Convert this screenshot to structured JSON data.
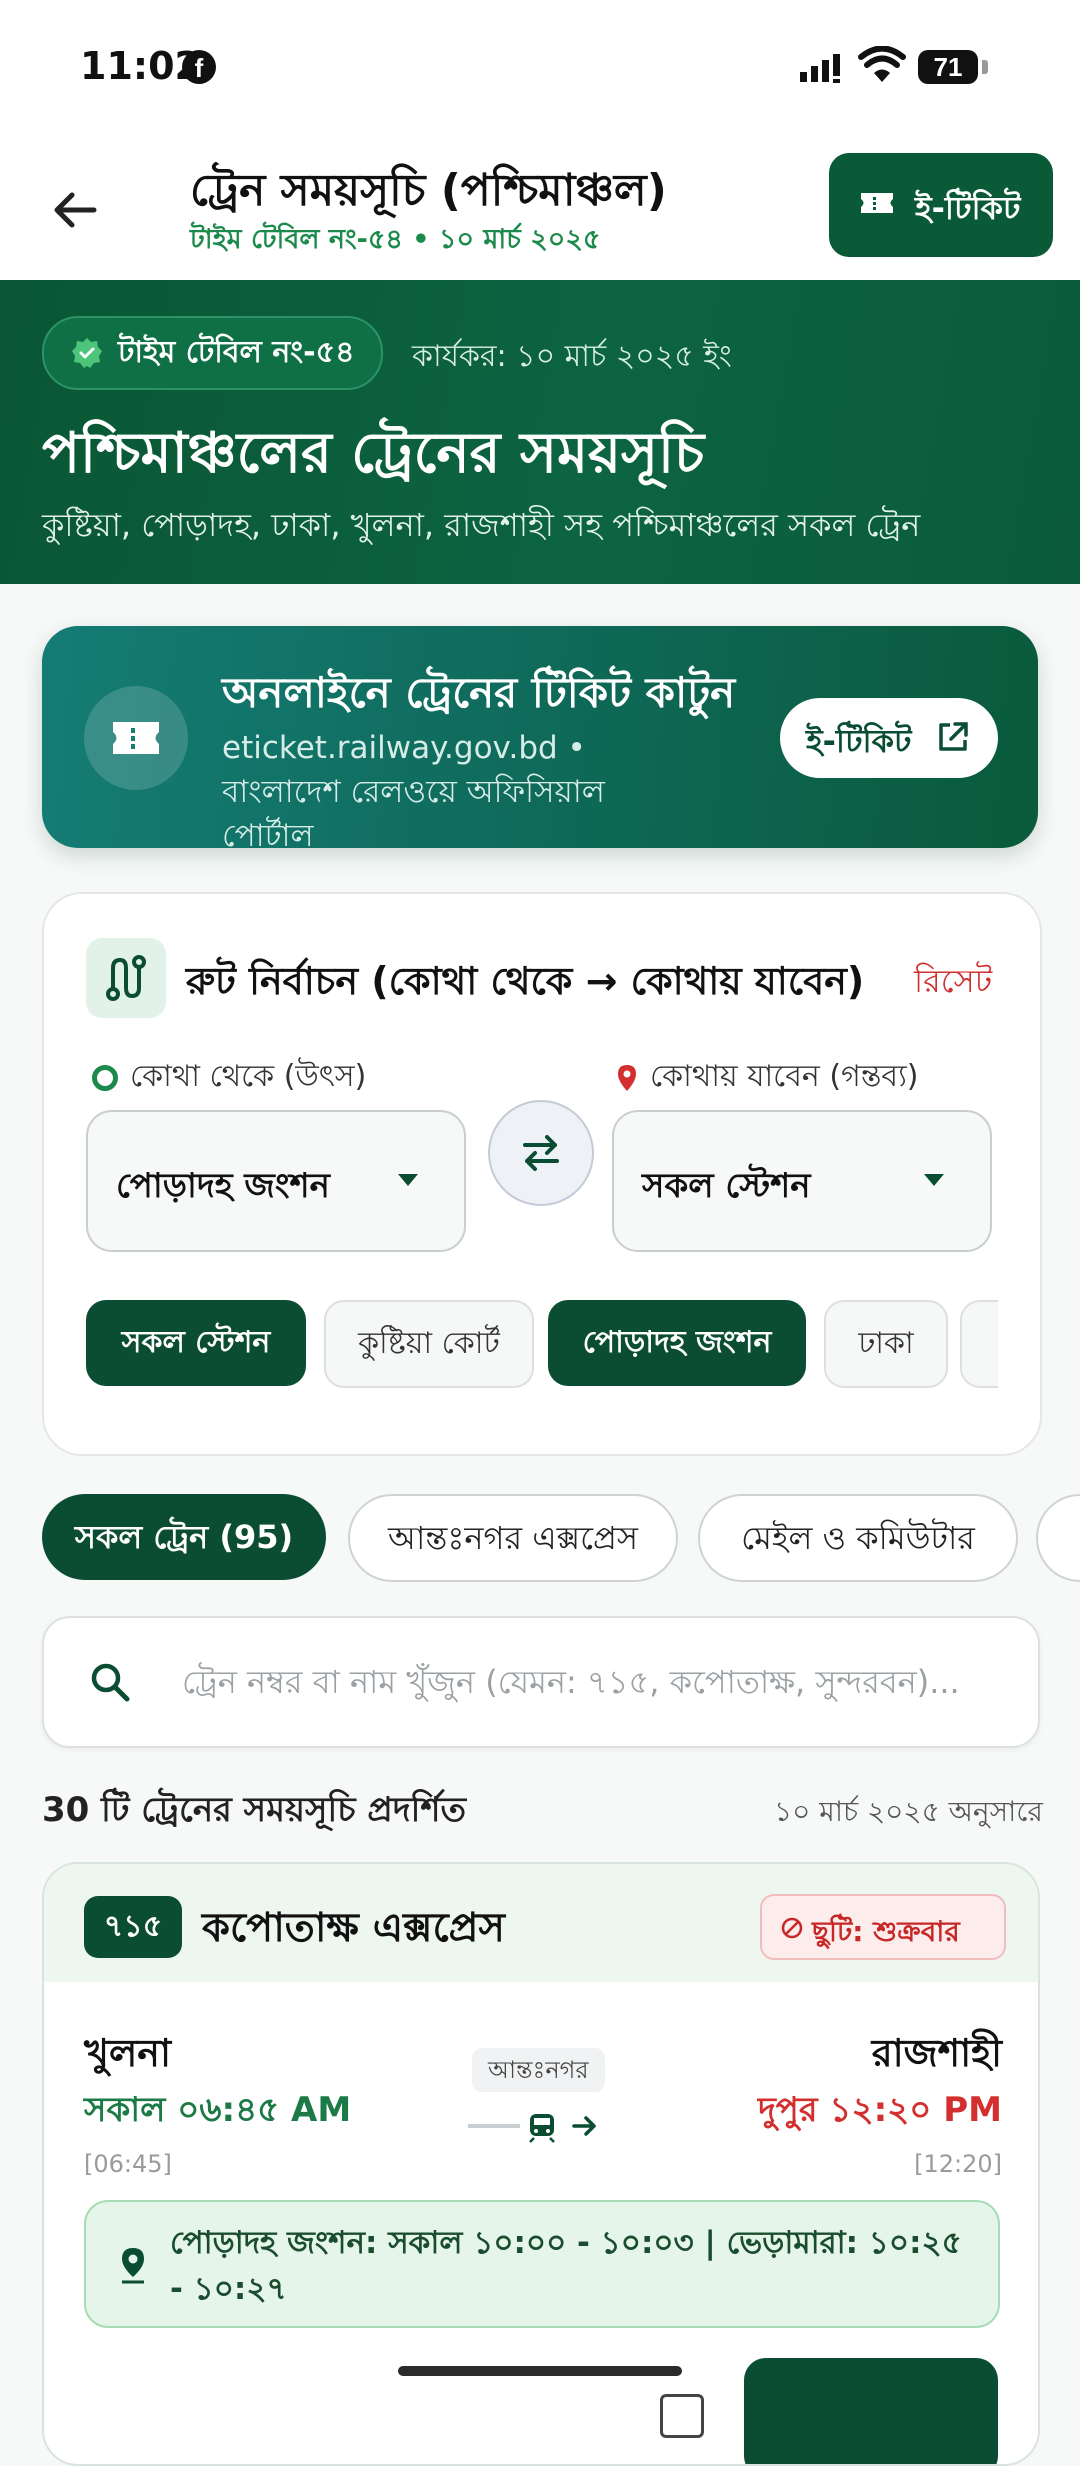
{
  "status_bar": {
    "time": "11:02",
    "battery": "71"
  },
  "app_bar": {
    "title": "ট্রেন সময়সূচি (পশ্চিমাঞ্চল)",
    "subtitle": "টাইম টেবিল নং-৫৪ • ১০ মার্চ ২০২৫",
    "eticket_label": "ই-টিকিট"
  },
  "hero": {
    "badge": "টাইম টেবিল নং-৫৪",
    "effective": "কার্যকর: ১০ মার্চ ২০২৫ ইং",
    "title": "পশ্চিমাঞ্চলের ট্রেনের সময়সূচি",
    "description": "কুষ্টিয়া, পোড়াদহ, ঢাকা, খুলনা, রাজশাহী সহ পশ্চিমাঞ্চলের সকল ট্রেন"
  },
  "online_banner": {
    "title": "অনলাইনে ট্রেনের টিকিট কাটুন",
    "subtitle": "eticket.railway.gov.bd • বাংলাদেশ রেলওয়ে অফিসিয়াল পোর্টাল",
    "button": "ই-টিকিট"
  },
  "route_selector": {
    "title": "রুট নির্বাচন (কোথা থেকে → কোথায় যাবেন)",
    "reset": "রিসেট",
    "from_label": "কোথা থেকে (উৎস)",
    "to_label": "কোথায় যাবেন (গন্তব্য)",
    "from_value": "পোড়াদহ জংশন",
    "to_value": "সকল স্টেশন",
    "chips": [
      {
        "label": "সকল স্টেশন",
        "active": true
      },
      {
        "label": "কুষ্টিয়া কোর্ট",
        "active": false
      },
      {
        "label": "পোড়াদহ জংশন",
        "active": true
      },
      {
        "label": "ঢাকা",
        "active": false
      }
    ]
  },
  "filter_tabs": [
    {
      "label": "সকল ট্রেন (95)",
      "active": true
    },
    {
      "label": "আন্তঃনগর এক্সপ্রেস",
      "active": false
    },
    {
      "label": "মেইল ও কমিউটার",
      "active": false
    }
  ],
  "search": {
    "placeholder": "ট্রেন নম্বর বা নাম খুঁজুন (যেমন: ৭১৫, কপোতাক্ষ, সুন্দরবন)..."
  },
  "results": {
    "count": "30 টি ট্রেনের সময়সূচি প্রদর্শিত",
    "as_of": "১০ মার্চ ২০২৫ অনুসারে"
  },
  "train_card": {
    "number": "৭১৫",
    "name": "কপোতাক্ষ এক্সপ্রেস",
    "holiday": "ছুটি: শুক্রবার",
    "from_station": "খুলনা",
    "from_time": "সকাল ০৬:৪৫ AM",
    "from_time_24": "[06:45]",
    "to_station": "রাজশাহী",
    "to_time": "দুপুর ১২:২০ PM",
    "to_time_24": "[12:20]",
    "type": "আন্তঃনগর",
    "stops": "পোড়াদহ জংশন: সকাল ১০:০০ - ১০:০৩ | ভেড়ামারা: ১০:২৫ - ১০:২৭"
  },
  "colors": {
    "primary": "#0b4d33",
    "accent_green": "#1b8a4b",
    "danger": "#d32f2f"
  }
}
